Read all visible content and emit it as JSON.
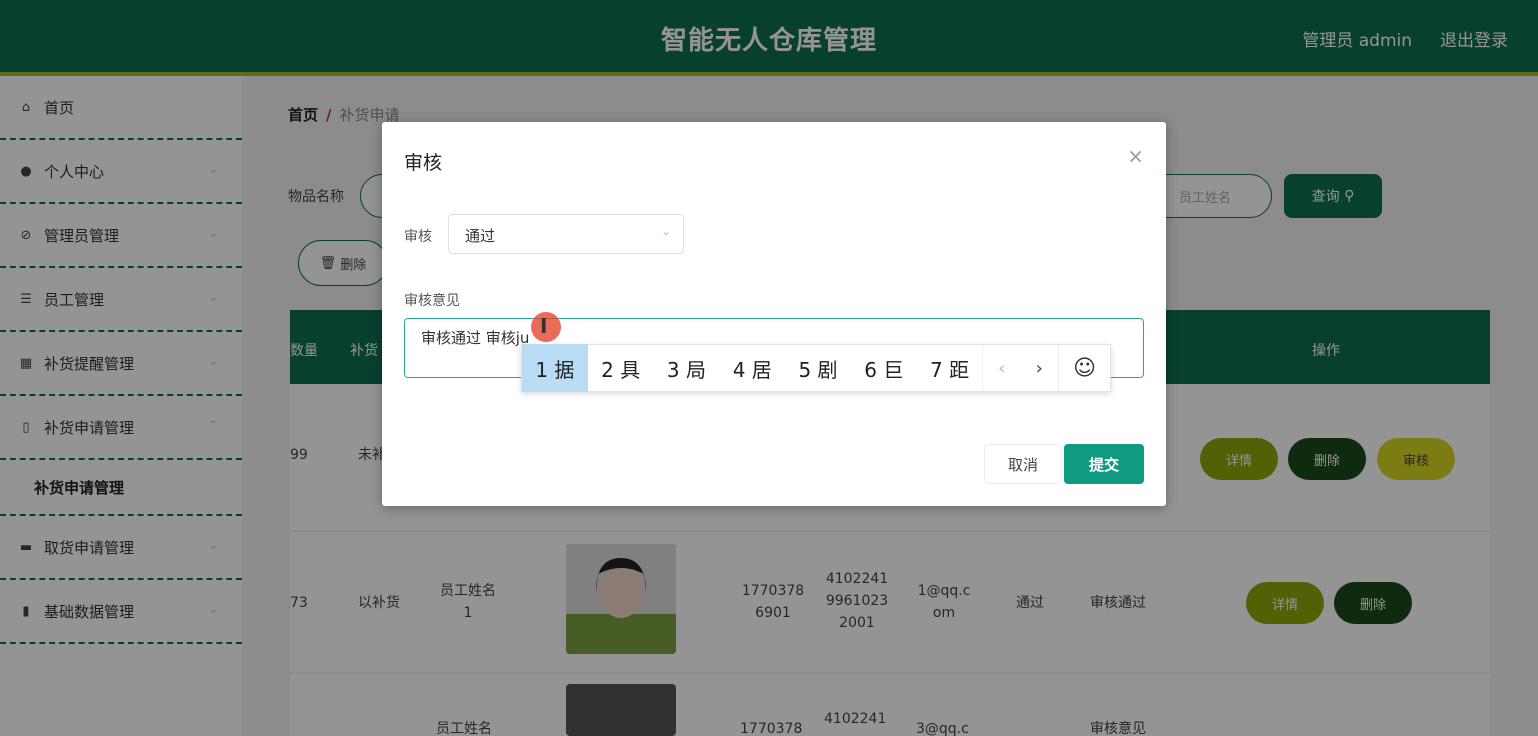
{
  "header": {
    "title": "智能无人仓库管理",
    "user": "管理员 admin",
    "logout": "退出登录"
  },
  "sidebar": {
    "items": [
      {
        "label": "首页",
        "icon": "home-icon"
      },
      {
        "label": "个人中心",
        "icon": "user-icon"
      },
      {
        "label": "管理员管理",
        "icon": "admin-icon"
      },
      {
        "label": "员工管理",
        "icon": "list-icon"
      },
      {
        "label": "补货提醒管理",
        "icon": "calendar-icon"
      },
      {
        "label": "补货申请管理",
        "icon": "clipboard-icon"
      },
      {
        "label": "取货申请管理",
        "icon": "briefcase-icon"
      },
      {
        "label": "基础数据管理",
        "icon": "bar-chart-icon"
      }
    ],
    "sub_item": "补货申请管理"
  },
  "breadcrumb": {
    "home": "首页",
    "sep": "/",
    "current": "补货申请"
  },
  "search": {
    "label": "物品名称",
    "placeholder2": "员工姓名",
    "button": "查询"
  },
  "toolbar": {
    "delete": "删除"
  },
  "table": {
    "headers": {
      "count": "数量",
      "status": "补货",
      "ops": "操作"
    },
    "rows": [
      {
        "count": "99",
        "status": "未补",
        "ops": [
          "详情",
          "删除",
          "审核"
        ]
      },
      {
        "count": "73",
        "status": "以补货",
        "name": "员工姓名1",
        "phone": "17703786901",
        "id": "410224199610232001",
        "email": "1@qq.com",
        "audit": "通过",
        "opinion": "审核通过",
        "ops": [
          "详情",
          "删除"
        ]
      },
      {
        "name": "员工姓名",
        "phone": "1770378",
        "id": "4102241",
        "email": "3@qq.c",
        "opinion": "审核意见"
      }
    ]
  },
  "dialog": {
    "title": "审核",
    "close": "×",
    "audit_label": "审核",
    "audit_value": "通过",
    "opinion_label": "审核意见",
    "opinion_text": "审核通过 审核ju",
    "cancel": "取消",
    "submit": "提交"
  },
  "ime": {
    "candidates": [
      "1 据",
      "2 具",
      "3 局",
      "4 居",
      "5 剧",
      "6 巨",
      "7 距"
    ],
    "prev": "‹",
    "next": "›",
    "emoji": "☺"
  }
}
